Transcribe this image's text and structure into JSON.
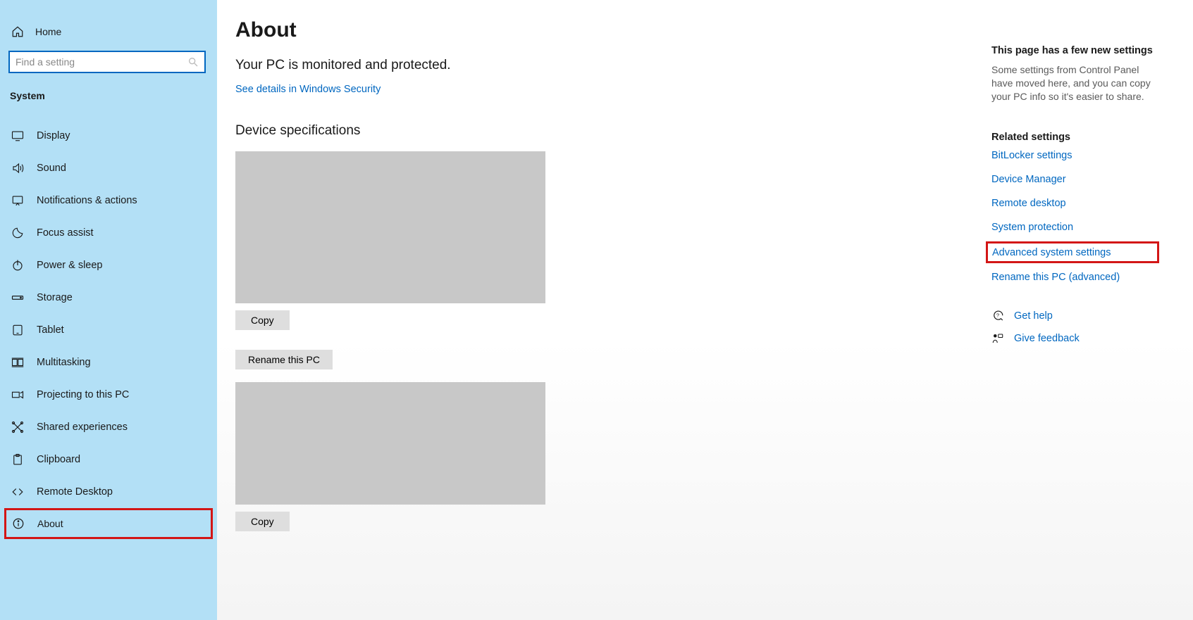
{
  "sidebar": {
    "home_label": "Home",
    "search_placeholder": "Find a setting",
    "section_label": "System",
    "items": [
      {
        "label": "Display"
      },
      {
        "label": "Sound"
      },
      {
        "label": "Notifications & actions"
      },
      {
        "label": "Focus assist"
      },
      {
        "label": "Power & sleep"
      },
      {
        "label": "Storage"
      },
      {
        "label": "Tablet"
      },
      {
        "label": "Multitasking"
      },
      {
        "label": "Projecting to this PC"
      },
      {
        "label": "Shared experiences"
      },
      {
        "label": "Clipboard"
      },
      {
        "label": "Remote Desktop"
      },
      {
        "label": "About"
      }
    ]
  },
  "main": {
    "title": "About",
    "monitored_heading": "Your PC is monitored and protected.",
    "security_link": "See details in Windows Security",
    "device_spec_heading": "Device specifications",
    "copy_label": "Copy",
    "rename_label": "Rename this PC"
  },
  "right": {
    "new_heading": "This page has a few new settings",
    "new_text": "Some settings from Control Panel have moved here, and you can copy your PC info so it's easier to share.",
    "related_heading": "Related settings",
    "links": [
      "BitLocker settings",
      "Device Manager",
      "Remote desktop",
      "System protection",
      "Advanced system settings",
      "Rename this PC (advanced)"
    ],
    "get_help": "Get help",
    "give_feedback": "Give feedback"
  }
}
